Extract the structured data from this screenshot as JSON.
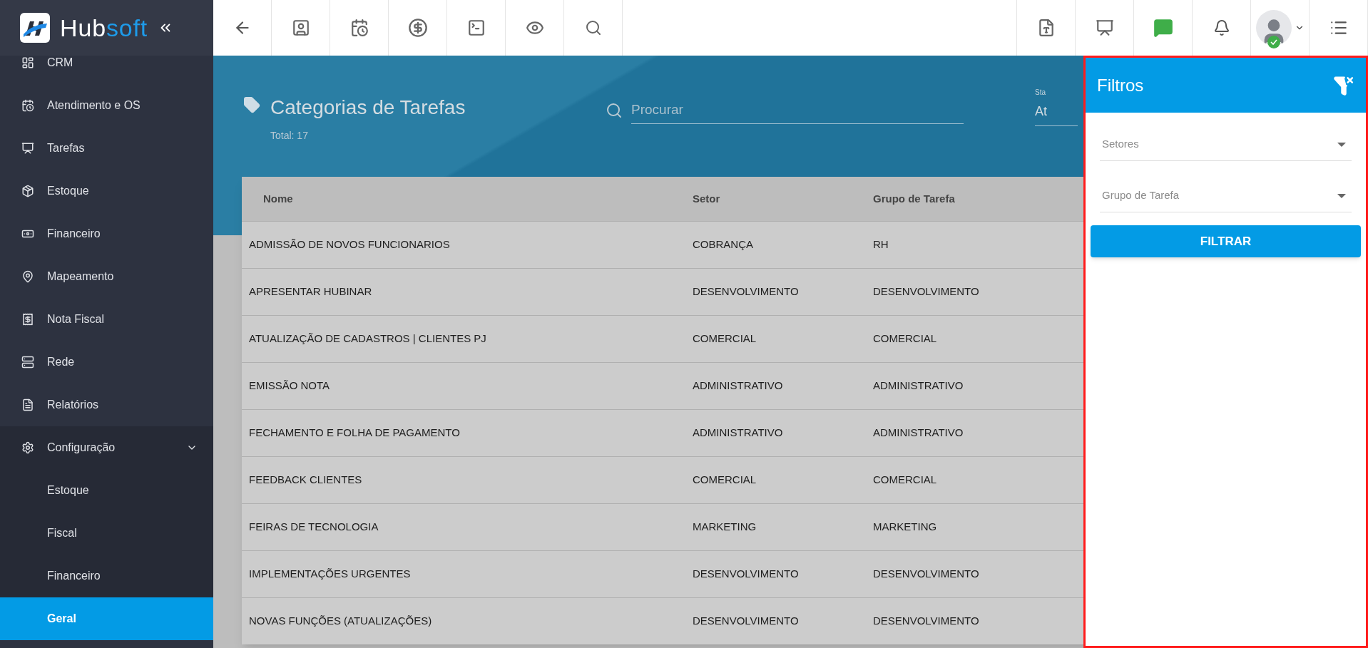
{
  "sidebar": {
    "logo": {
      "first": "Hub",
      "second": "soft"
    },
    "items": [
      {
        "label": "CRM"
      },
      {
        "label": "Atendimento e OS"
      },
      {
        "label": "Tarefas"
      },
      {
        "label": "Estoque"
      },
      {
        "label": "Financeiro"
      },
      {
        "label": "Mapeamento"
      },
      {
        "label": "Nota Fiscal"
      },
      {
        "label": "Rede"
      },
      {
        "label": "Relatórios"
      },
      {
        "label": "Configuração",
        "expanded": true,
        "children": [
          {
            "label": "Estoque",
            "selected": false
          },
          {
            "label": "Fiscal",
            "selected": false
          },
          {
            "label": "Financeiro",
            "selected": false
          },
          {
            "label": "Geral",
            "selected": true
          }
        ]
      }
    ]
  },
  "header": {
    "title": "Categorias de Tarefas",
    "total": "Total: 17",
    "search": {
      "placeholder": "Procurar"
    },
    "status_field": {
      "label": "Sta",
      "value": "At"
    }
  },
  "table": {
    "columns": [
      "Nome",
      "Setor",
      "Grupo de Tarefa"
    ],
    "rows": [
      [
        "ADMISSÃO DE NOVOS FUNCIONARIOS",
        "COBRANÇA",
        "RH"
      ],
      [
        "APRESENTAR HUBINAR",
        "DESENVOLVIMENTO",
        "DESENVOLVIMENTO"
      ],
      [
        "ATUALIZAÇÃO DE CADASTROS | CLIENTES PJ",
        "COMERCIAL",
        "COMERCIAL"
      ],
      [
        "EMISSÃO NOTA",
        "ADMINISTRATIVO",
        "ADMINISTRATIVO"
      ],
      [
        "FECHAMENTO E FOLHA DE PAGAMENTO",
        "ADMINISTRATIVO",
        "ADMINISTRATIVO"
      ],
      [
        "FEEDBACK CLIENTES",
        "COMERCIAL",
        "COMERCIAL"
      ],
      [
        "FEIRAS DE TECNOLOGIA",
        "MARKETING",
        "MARKETING"
      ],
      [
        "IMPLEMENTAÇÕES URGENTES",
        "DESENVOLVIMENTO",
        "DESENVOLVIMENTO"
      ],
      [
        "NOVAS FUNÇÕES (ATUALIZAÇÕES)",
        "DESENVOLVIMENTO",
        "DESENVOLVIMENTO"
      ]
    ]
  },
  "filter_panel": {
    "title": "Filtros",
    "fields": [
      {
        "placeholder": "Setores"
      },
      {
        "placeholder": "Grupo de Tarefa"
      }
    ],
    "button": "FILTRAR"
  }
}
